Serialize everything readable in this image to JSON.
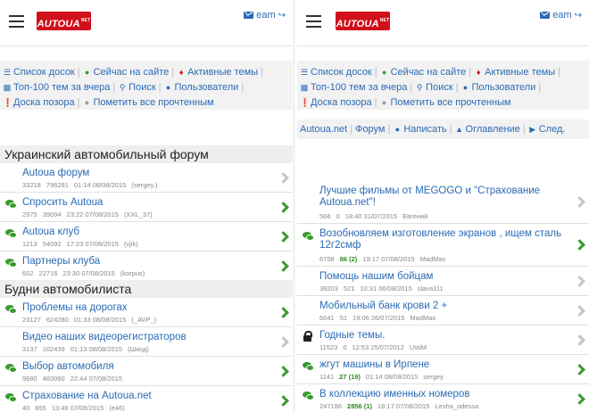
{
  "left": {
    "user": "eam",
    "nav": {
      "list_forums": "Список досок",
      "online": "Сейчас на сайте",
      "active": "Активные темы",
      "top100": "Топ-100 тем за вчера",
      "search": "Поиск",
      "users": "Пользователи",
      "shame": "Доска позора",
      "mark_read": "Пометить все прочтенным"
    },
    "sections": [
      {
        "title": "Украинский автомобильный форум",
        "rows": [
          {
            "title": "Autoua форум",
            "topics": "33218",
            "posts": "796281",
            "time": "01:14 08/08/2015",
            "user": "(sergey.)",
            "icon": "none"
          },
          {
            "title": "Спросить Autoua",
            "topics": "2975",
            "posts": "39094",
            "time": "23:22 07/08/2015",
            "user": "(XXL_37)",
            "icon": "new"
          },
          {
            "title": "Autoua клуб",
            "topics": "1213",
            "posts": "54092",
            "time": "17:23 07/08/2015",
            "user": "(vjik)",
            "icon": "new"
          },
          {
            "title": "Партнеры клуба",
            "topics": "602",
            "posts": "22716",
            "time": "23:30 07/08/2015",
            "user": "(korpus)",
            "icon": "new"
          }
        ]
      },
      {
        "title": "Будни автомобилиста",
        "rows": [
          {
            "title": "Проблемы на дорогах",
            "topics": "23127",
            "posts": "624280",
            "time": "01:33 08/08/2015",
            "user": "(_AVP_)",
            "icon": "new"
          },
          {
            "title": "Видео наших видеорегистраторов",
            "topics": "3137",
            "posts": "102439",
            "time": "01:13 08/08/2015",
            "user": "(Шкод)",
            "icon": "none"
          },
          {
            "title": "Выбор автомобиля",
            "topics": "9680",
            "posts": "483060",
            "time": "22:44 07/08/2015",
            "user": "",
            "icon": "new"
          },
          {
            "title": "Страхование на Autoua.net",
            "topics": "40",
            "posts": "855",
            "time": "13:46 07/08/2015",
            "user": "(e46)",
            "icon": "new"
          }
        ]
      }
    ]
  },
  "right": {
    "user": "eam",
    "nav": {
      "list_forums": "Список досок",
      "online": "Сейчас на сайте",
      "active": "Активные темы",
      "top100": "Топ-100 тем за вчера",
      "search": "Поиск",
      "users": "Пользователи",
      "shame": "Доска позора",
      "mark_read": "Пометить все прочтенным"
    },
    "crumbs": {
      "site": "Autoua.net",
      "forum": "Форум",
      "write": "Написать",
      "contents": "Оглавление",
      "next": "След."
    },
    "topics": [
      {
        "title": "Лучшие фильмы от MEGOGO и \"Страхование Autoua.net\"!",
        "views": "566",
        "replies": "0",
        "time": "18:40 31/07/2015",
        "user": "Евгений",
        "icon": "none",
        "lines": 2
      },
      {
        "title": "Возобновляем изготовление экранов , ищем сталь 12г2смф",
        "views": "6758",
        "replies": "86 (2)",
        "time": "19:17 07/08/2015",
        "user": "MadMax",
        "icon": "new",
        "lines": 2
      },
      {
        "title": "Помощь нашим бойцам",
        "views": "38203",
        "replies": "521",
        "time": "10:31 06/08/2015",
        "user": "slava111",
        "icon": "none",
        "lines": 1
      },
      {
        "title": "Мобильный банк крови 2 +",
        "views": "6641",
        "replies": "51",
        "time": "19:06 26/07/2015",
        "user": "MadMax",
        "icon": "none",
        "lines": 1
      },
      {
        "title": "Годные темы.",
        "views": "11523",
        "replies": "0",
        "time": "12:53 25/07/2012",
        "user": "UstiM",
        "icon": "lock",
        "lines": 1
      },
      {
        "title": "жгут машины в Ирпене",
        "views": "1141",
        "replies": "27 (19)",
        "time": "01:14 08/08/2015",
        "user": "sergey.",
        "icon": "new",
        "lines": 1
      },
      {
        "title": "В коллекцию именных номеров",
        "views": "247186",
        "replies": "2856 (1)",
        "time": "18:17 07/08/2015",
        "user": "Lesha_odessa",
        "icon": "new",
        "lines": 1
      }
    ]
  }
}
